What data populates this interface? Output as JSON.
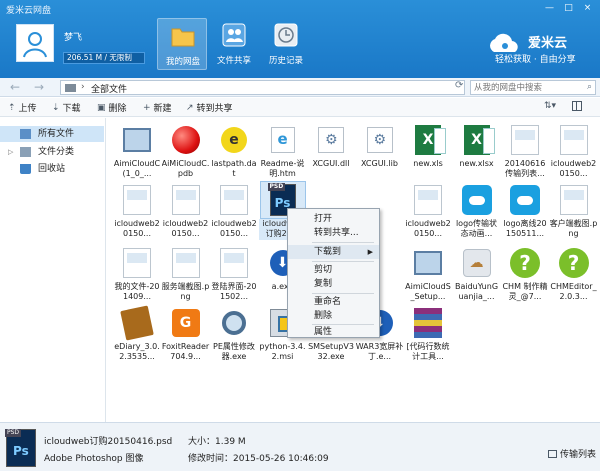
{
  "app": {
    "title": "爱米云网盘",
    "window_buttons": [
      "—",
      "□",
      "×"
    ]
  },
  "user": {
    "name": "梦飞",
    "quota": "206.51 M / 无限制"
  },
  "nav_tabs": [
    {
      "label": "我的网盘",
      "icon": "folder-icon",
      "active": true
    },
    {
      "label": "文件共享",
      "icon": "share-users-icon",
      "active": false
    },
    {
      "label": "历史记录",
      "icon": "clock-icon",
      "active": false
    }
  ],
  "brand": {
    "name": "爱米云",
    "slogan": "轻松获取 · 自由分享",
    "color": "#ffffff"
  },
  "address": {
    "path": "全部文件",
    "search_placeholder": "从我的网盘中搜索"
  },
  "toolbar": {
    "upload": "上传",
    "download": "下载",
    "delete": "删除",
    "new": "新建",
    "share": "转到共享"
  },
  "sidebar": [
    {
      "label": "所有文件",
      "icon": "files-icon",
      "active": true,
      "expander": ""
    },
    {
      "label": "文件分类",
      "icon": "category-icon",
      "active": false,
      "expander": "▷"
    },
    {
      "label": "回收站",
      "icon": "recycle-bin-icon",
      "active": false,
      "expander": ""
    }
  ],
  "files": [
    {
      "name": "AimiCloudC(1_0_...",
      "icon": "computer"
    },
    {
      "name": "AiMiCloudC.pdb",
      "icon": "redball"
    },
    {
      "name": "lastpath.dat",
      "icon": "yellow-dat"
    },
    {
      "name": "Readme-说明.htm",
      "icon": "ie"
    },
    {
      "name": "XCGUI.dll",
      "icon": "gear"
    },
    {
      "name": "XCGUI.lib",
      "icon": "gear"
    },
    {
      "name": "new.xls",
      "icon": "xls"
    },
    {
      "name": "new.xlsx",
      "icon": "xls"
    },
    {
      "name": "20140616传输列表...",
      "icon": "thumb"
    },
    {
      "name": "icloudweb20150...",
      "icon": "thumb"
    },
    {
      "name": "icloudweb20150...",
      "icon": "thumb"
    },
    {
      "name": "icloudweb20150...",
      "icon": "thumb"
    },
    {
      "name": "icloudweb20150...",
      "icon": "thumb"
    },
    {
      "name": "icloudweb订购20...",
      "icon": "ps",
      "selected": true
    },
    {
      "name": "",
      "icon": "none"
    },
    {
      "name": "",
      "icon": "none"
    },
    {
      "name": "icloudweb20150...",
      "icon": "thumb"
    },
    {
      "name": "logo传输状态动画...",
      "icon": "cloud-tile"
    },
    {
      "name": "logo离线20150511...",
      "icon": "cloud-tile"
    },
    {
      "name": "客户端截图.png",
      "icon": "thumb"
    },
    {
      "name": "我的文件-201409...",
      "icon": "thumb"
    },
    {
      "name": "服务端截图.png",
      "icon": "thumb"
    },
    {
      "name": "登陆界面-201502...",
      "icon": "thumb"
    },
    {
      "name": "a.exe",
      "icon": "arrowdl"
    },
    {
      "name": "",
      "icon": "none"
    },
    {
      "name": "",
      "icon": "none"
    },
    {
      "name": "AimiCloudS_Setup...",
      "icon": "computer"
    },
    {
      "name": "BaiduYunGuanjia_...",
      "icon": "baidu"
    },
    {
      "name": "CHM 制作精灵_@7...",
      "icon": "help"
    },
    {
      "name": "CHMEditor_2.0.3...",
      "icon": "help"
    },
    {
      "name": "eDiary_3.0.2.3535...",
      "icon": "book"
    },
    {
      "name": "FoxitReader704.9...",
      "icon": "foxit"
    },
    {
      "name": "PE属性修改器.exe",
      "icon": "mag"
    },
    {
      "name": "python-3.4.2.msi",
      "icon": "py"
    },
    {
      "name": "SMSetupV332.exe",
      "icon": "setup"
    },
    {
      "name": "WAR3宽屏补丁.e...",
      "icon": "arrowdl"
    },
    {
      "name": "[代码行数统计工具...",
      "icon": "rar"
    }
  ],
  "context_menu": [
    {
      "label": "打开",
      "submenu": false,
      "highlight": false
    },
    {
      "label": "转到共享...",
      "submenu": false,
      "highlight": false
    },
    {
      "label": "下载到",
      "submenu": true,
      "highlight": true
    },
    {
      "label": "剪切",
      "submenu": false,
      "highlight": false
    },
    {
      "label": "复制",
      "submenu": false,
      "highlight": false
    },
    {
      "label": "重命名",
      "submenu": false,
      "highlight": false
    },
    {
      "label": "删除",
      "submenu": false,
      "highlight": false
    },
    {
      "label": "属性",
      "submenu": false,
      "highlight": false
    }
  ],
  "status": {
    "file_name": "icloudweb订购20150416.psd",
    "file_type": "Adobe Photoshop 图像",
    "size": "大小：1.39 M",
    "modified": "修改时间：2015-05-26 10:46:09",
    "transfer_list": "传输列表"
  }
}
